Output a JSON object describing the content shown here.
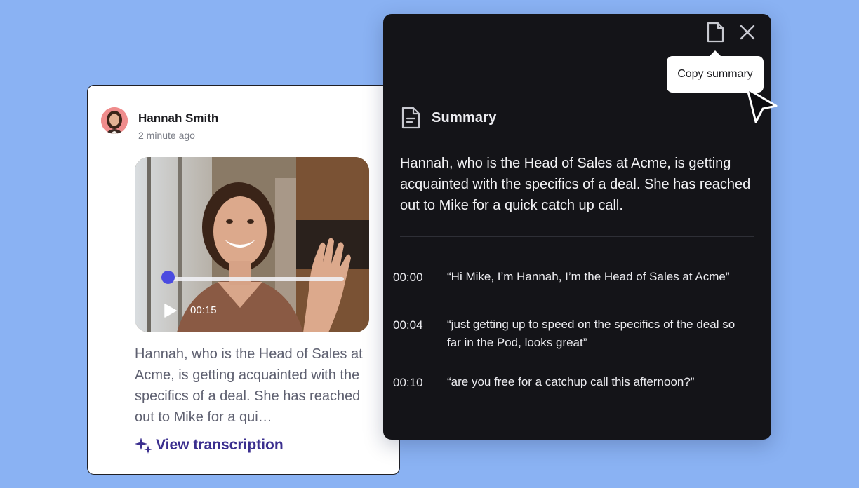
{
  "message": {
    "author": "Hannah Smith",
    "timestamp": "2 minute ago",
    "video": {
      "time": "00:15",
      "progress": 0.03
    },
    "preview": "Hannah, who is the Head of Sales at Acme, is getting acquainted with the specifics of a deal. She has reached out to Mike for a qui…",
    "view_link": "View transcription"
  },
  "panel": {
    "tooltip": "Copy summary",
    "title": "Summary",
    "summary": "Hannah, who is the Head of Sales at Acme, is getting acquainted with the specifics of a deal. She has reached out to Mike for a quick catch up call.",
    "transcript": [
      {
        "time": "00:00",
        "text": "“Hi Mike, I’m Hannah, I’m the Head of Sales at Acme”"
      },
      {
        "time": "00:04",
        "text": "“just getting up to speed on the specifics of the deal so far in the Pod, looks great”"
      },
      {
        "time": "00:10",
        "text": "“are you free for a catchup call this afternoon?”"
      }
    ]
  },
  "colors": {
    "background": "#8ab2f3",
    "panel": "#141418",
    "accent": "#4b4be0",
    "link": "#3b2f8f"
  }
}
